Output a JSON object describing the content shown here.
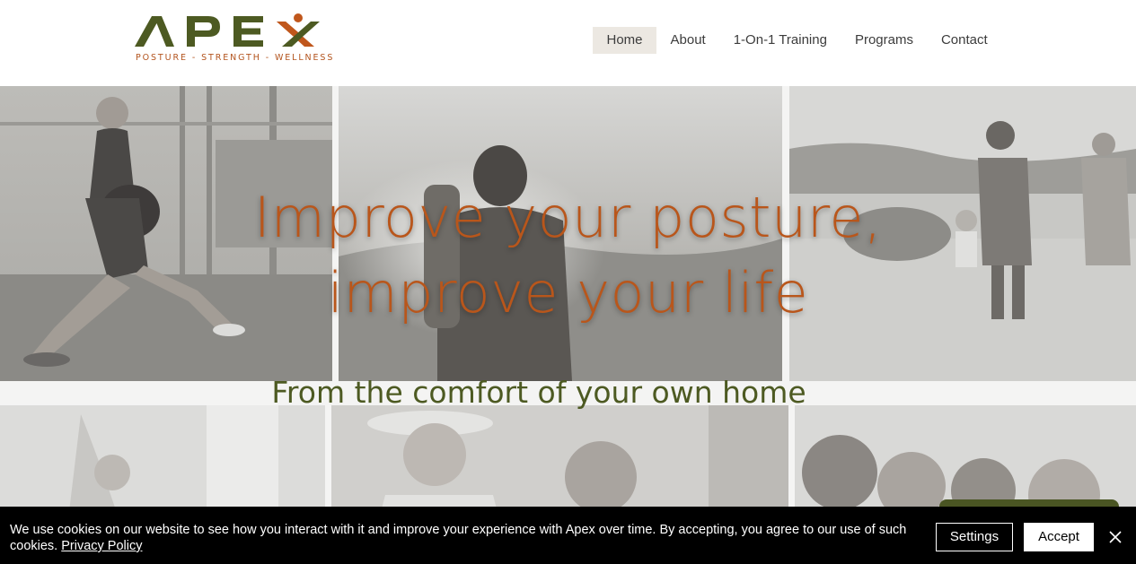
{
  "brand": {
    "name": "APEX",
    "tagline": "POSTURE - STRENGTH - WELLNESS",
    "colors": {
      "olive": "#4d5a22",
      "orange": "#c0571c"
    }
  },
  "nav": {
    "items": [
      {
        "label": "Home",
        "active": true
      },
      {
        "label": "About"
      },
      {
        "label": "1-On-1 Training"
      },
      {
        "label": "Programs"
      },
      {
        "label": "Contact"
      }
    ]
  },
  "hero": {
    "headline_line1": "Improve your posture,",
    "headline_line2": "improve your life",
    "subheadline": "From the comfort of your own home",
    "accent_color": "#b9561b"
  },
  "cookie": {
    "text": "We use cookies on our website to see how you interact with it and improve your experience with Apex over time. By accepting, you agree to our use of such cookies.",
    "privacy_link": "Privacy Policy",
    "settings_label": "Settings",
    "accept_label": "Accept",
    "close_icon": "close-icon"
  }
}
